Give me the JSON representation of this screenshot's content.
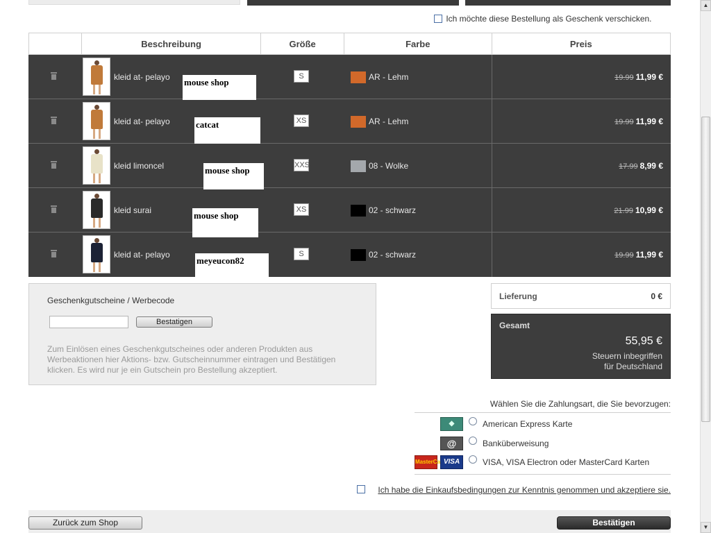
{
  "gift": {
    "label": "Ich möchte diese Bestellung als Geschenk verschicken."
  },
  "table": {
    "headers": [
      "",
      "Beschreibung",
      "Größe",
      "Farbe",
      "Preis"
    ],
    "rows": [
      {
        "name": "kleid at- pelayo",
        "overlay": "mouse shop",
        "size": "S",
        "color_name": "AR - Lehm",
        "swatch": "#d2692a",
        "old_price": "19.99",
        "price": "11,99 €",
        "dress": "#c07a3a"
      },
      {
        "name": "kleid at- pelayo",
        "overlay": "catcat",
        "size": "XS",
        "color_name": "AR - Lehm",
        "swatch": "#d2692a",
        "old_price": "19.99",
        "price": "11,99 €",
        "dress": "#c07a3a"
      },
      {
        "name": "kleid limoncel",
        "overlay": "mouse shop",
        "size": "XXS",
        "color_name": "08 - Wolke",
        "swatch": "#a4a8ac",
        "old_price": "17.99",
        "price": "8,99 €",
        "dress": "#e8e2c8"
      },
      {
        "name": "kleid surai",
        "overlay": "mouse shop",
        "size": "XS",
        "color_name": "02 - schwarz",
        "swatch": "#000000",
        "old_price": "21.99",
        "price": "10,99 €",
        "dress": "#2a2a2a"
      },
      {
        "name": "kleid at- pelayo",
        "overlay": "meyeucon82",
        "size": "S",
        "color_name": "02 - schwarz",
        "swatch": "#000000",
        "old_price": "19.99",
        "price": "11,99 €",
        "dress": "#1c2235"
      }
    ]
  },
  "voucher": {
    "title": "Geschenkgutscheine / Werbecode",
    "input_value": "",
    "button": "Bestatigen",
    "help": "Zum Einlösen eines Geschenkgutscheines oder anderen Produkten aus Werbeaktionen hier Aktions- bzw. Gutscheinnummer eintragen und Bestätigen klicken. Es wird nur je ein Gutschein pro Bestellung akzeptiert."
  },
  "totals": {
    "delivery_label": "Lieferung",
    "delivery_value": "0 €",
    "total_label": "Gesamt",
    "total_value": "55,95 €",
    "tax_line1": "Steuern inbegriffen",
    "tax_line2": "für Deutschland"
  },
  "payment": {
    "title": "Wählen Sie die Zahlungsart, die Sie bevorzugen:",
    "options": [
      {
        "label": "American Express Karte",
        "icon": "amex-card-icon"
      },
      {
        "label": "Banküberweisung",
        "icon": "at-sign-icon"
      },
      {
        "label": "VISA, VISA Electron oder MasterCard Karten",
        "icon": "visa-mastercard-icon"
      }
    ],
    "mastercard_text": "MasterCard",
    "visa_text": "VISA"
  },
  "terms": {
    "label": "Ich habe die Einkaufsbedingungen zur Kenntnis genommen und akzeptiere sie."
  },
  "buttons": {
    "back": "Zurück zum Shop",
    "confirm": "Bestätigen"
  }
}
